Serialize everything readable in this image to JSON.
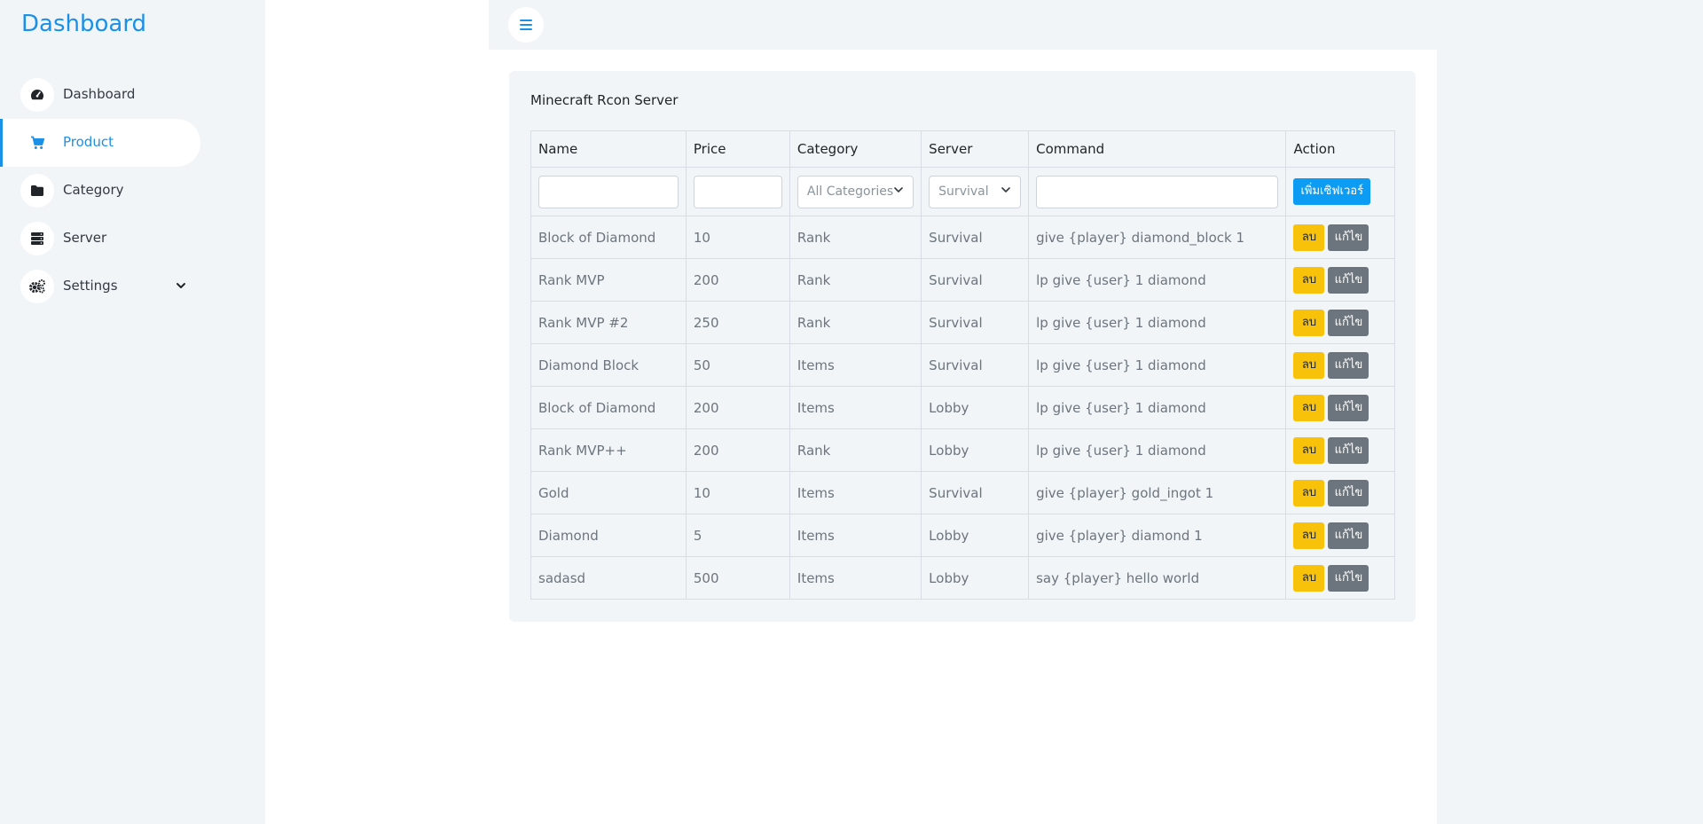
{
  "sidebar": {
    "brand": "Dashboard",
    "items": [
      {
        "label": "Dashboard",
        "icon": "gauge-icon"
      },
      {
        "label": "Product",
        "icon": "cart-icon",
        "active": true
      },
      {
        "label": "Category",
        "icon": "folder-icon"
      },
      {
        "label": "Server",
        "icon": "server-icon"
      },
      {
        "label": "Settings",
        "icon": "gears-icon"
      }
    ]
  },
  "card": {
    "title": "Minecraft Rcon Server"
  },
  "table": {
    "headers": [
      "Name",
      "Price",
      "Category",
      "Server",
      "Command",
      "Action"
    ],
    "filter": {
      "category_selected": "All Categories",
      "server_selected": "Survival",
      "add_label": "เพิ่มเซิฟเวอร์"
    },
    "delete_label": "ลบ",
    "edit_label": "แก้ไข",
    "rows": [
      {
        "name": "Block of Diamond",
        "price": "10",
        "category": "Rank",
        "server": "Survival",
        "command": "give {player} diamond_block 1"
      },
      {
        "name": "Rank MVP",
        "price": "200",
        "category": "Rank",
        "server": "Survival",
        "command": "lp give {user} 1 diamond"
      },
      {
        "name": "Rank MVP #2",
        "price": "250",
        "category": "Rank",
        "server": "Survival",
        "command": "lp give {user} 1 diamond"
      },
      {
        "name": "Diamond Block",
        "price": "50",
        "category": "Items",
        "server": "Survival",
        "command": "lp give {user} 1 diamond"
      },
      {
        "name": "Block of Diamond",
        "price": "200",
        "category": "Items",
        "server": "Lobby",
        "command": "lp give {user} 1 diamond"
      },
      {
        "name": "Rank MVP++",
        "price": "200",
        "category": "Rank",
        "server": "Lobby",
        "command": "lp give {user} 1 diamond"
      },
      {
        "name": "Gold",
        "price": "10",
        "category": "Items",
        "server": "Survival",
        "command": "give {player} gold_ingot 1"
      },
      {
        "name": "Diamond",
        "price": "5",
        "category": "Items",
        "server": "Lobby",
        "command": "give {player} diamond 1"
      },
      {
        "name": "sadasd",
        "price": "500",
        "category": "Items",
        "server": "Lobby",
        "command": "say {player} hello world"
      }
    ]
  },
  "colors": {
    "accent": "#1a90e6",
    "panel": "#f1f5f8",
    "warning": "#f8c20a",
    "secondary": "#6c757d",
    "primary": "#0d9cf3"
  }
}
